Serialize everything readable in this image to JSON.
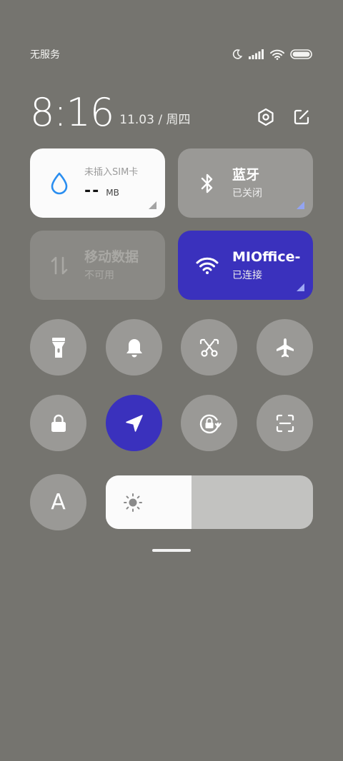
{
  "status": {
    "carrier": "无服务",
    "icons": [
      "moon-icon",
      "signal-icon",
      "wifi-icon",
      "battery-icon"
    ]
  },
  "clock": {
    "time": "8:16",
    "date": "11.03 / 周四",
    "icons": [
      "settings-icon",
      "edit-icon"
    ]
  },
  "tiles": {
    "data": {
      "title": "未插入SIM卡",
      "value": "--",
      "unit": "MB",
      "icon": "water-drop-icon"
    },
    "bluetooth": {
      "title": "蓝牙",
      "sub": "已关闭",
      "icon": "bluetooth-icon"
    },
    "mobile": {
      "title": "移动数据",
      "sub": "不可用",
      "icon": "mobile-data-icon"
    },
    "wifi": {
      "title": "MIOffice-",
      "sub": "已连接",
      "icon": "wifi-icon"
    }
  },
  "toggles": [
    {
      "name": "flashlight",
      "icon": "flashlight-icon",
      "active": false
    },
    {
      "name": "mute",
      "icon": "bell-icon",
      "active": false
    },
    {
      "name": "screenshot",
      "icon": "scissors-icon",
      "active": false
    },
    {
      "name": "airplane",
      "icon": "airplane-icon",
      "active": false
    },
    {
      "name": "lock",
      "icon": "lock-icon",
      "active": false
    },
    {
      "name": "location",
      "icon": "location-arrow-icon",
      "active": true
    },
    {
      "name": "rotation-lock",
      "icon": "rotation-lock-icon",
      "active": false
    },
    {
      "name": "scanner",
      "icon": "scan-icon",
      "active": false
    }
  ],
  "auto_brightness": {
    "label": "A"
  },
  "brightness": {
    "level": 0.414,
    "icon": "sun-icon"
  },
  "colors": {
    "background": "#75746f",
    "accent": "#3a31bd",
    "tile_inactive": "#9a9996",
    "tile_white": "#fbfbfb",
    "drop_blue": "#2a8ef0"
  }
}
